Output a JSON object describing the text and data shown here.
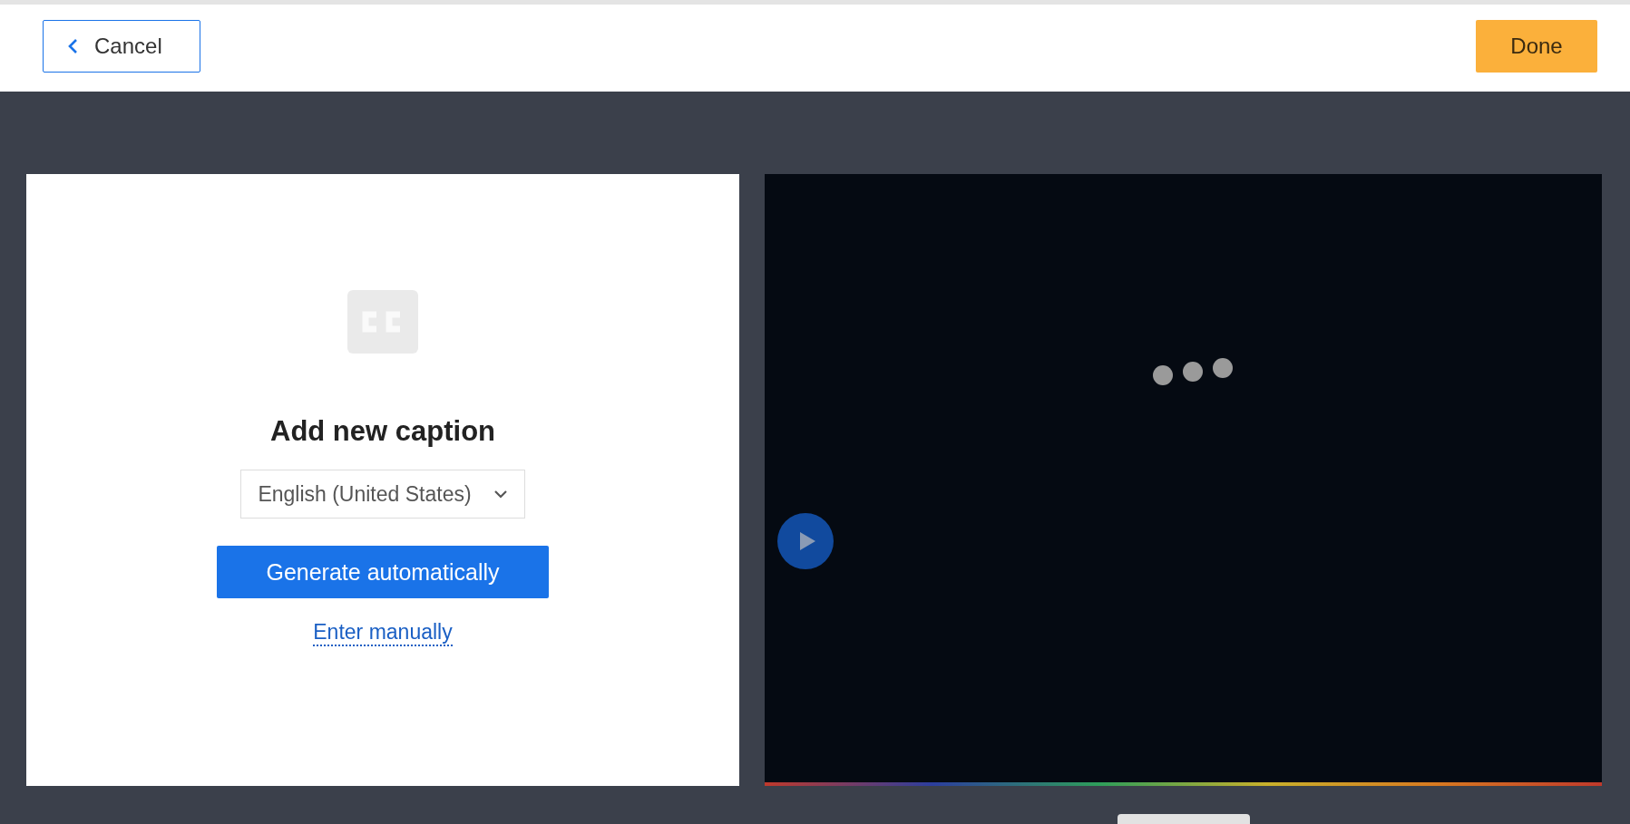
{
  "header": {
    "cancel_button": "Cancel",
    "done_button": "Done"
  },
  "caption_panel": {
    "title": "Add new caption",
    "language": "English (United States)",
    "generate_button": "Generate automatically",
    "manual_link": "Enter manually"
  }
}
